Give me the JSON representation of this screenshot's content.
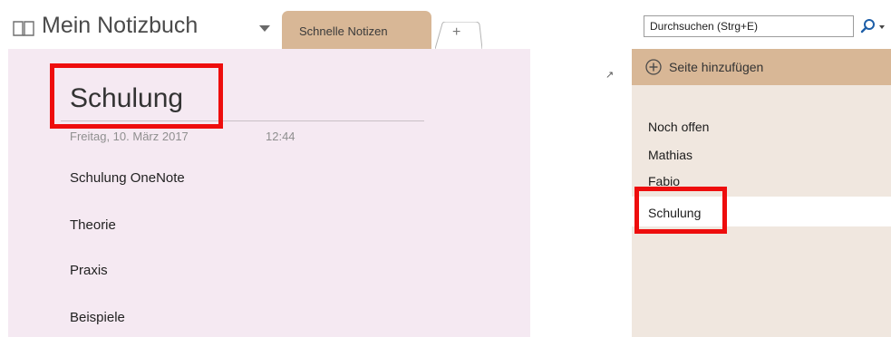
{
  "notebook": {
    "title": "Mein Notizbuch",
    "icon": "notebook-icon",
    "dropdown_icon": "chevron-down-icon"
  },
  "sections": {
    "tabs": [
      {
        "label": "Schnelle Notizen",
        "active": true
      }
    ],
    "add_tab_label": "+"
  },
  "page": {
    "title": "Schulung",
    "date": "Freitag, 10. März 2017",
    "time": "12:44",
    "lines": [
      "Schulung OneNote",
      "Theorie",
      "Praxis",
      "Beispiele"
    ]
  },
  "search": {
    "placeholder": "Durchsuchen (Strg+E)",
    "icon": "search-icon"
  },
  "page_list": {
    "add_page_label": "Seite hinzufügen",
    "add_page_icon": "plus-circle-icon",
    "expand_icon": "expand-arrow-icon",
    "items": [
      {
        "label": "Noch offen",
        "selected": false
      },
      {
        "label": "Mathias",
        "selected": false
      },
      {
        "label": "Fabio",
        "selected": false
      },
      {
        "label": "Schulung",
        "selected": true
      }
    ]
  },
  "colors": {
    "section_tab": "#d8b796",
    "page_background": "#f5e9f2",
    "page_list_background": "#f0e7df",
    "highlight": "#ee0d0d"
  }
}
